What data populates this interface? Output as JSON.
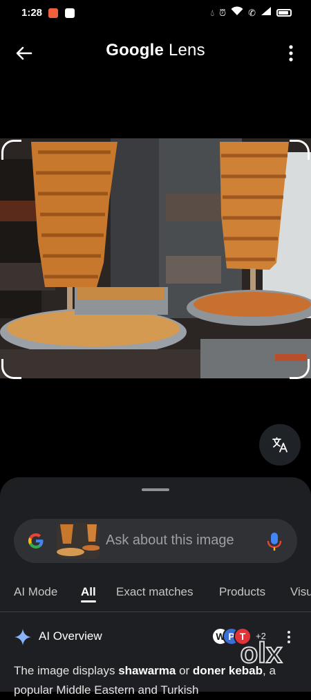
{
  "status_bar": {
    "time": "1:28"
  },
  "app_bar": {
    "title_google": "Google",
    "title_lens": "Lens"
  },
  "search": {
    "placeholder": "Ask about this image"
  },
  "tabs": [
    "AI Mode",
    "All",
    "Exact matches",
    "Products",
    "Visu"
  ],
  "active_tab": "All",
  "ai_overview": {
    "label": "AI Overview",
    "extra_sources": "+2",
    "text_parts": [
      "The image displays ",
      "shawarma",
      " or ",
      "doner kebab",
      ", a popular Middle Eastern and Turkish"
    ]
  },
  "watermark": "olx",
  "colors": {
    "background": "#000000",
    "sheet": "#1e1f22",
    "search_bar": "#303134",
    "accent_blue": "#8ab4f8"
  },
  "icons": {
    "back": "arrow-back-icon",
    "more": "more-vert-icon",
    "translate": "translate-icon",
    "mic": "mic-icon",
    "spark": "ai-spark-icon"
  }
}
